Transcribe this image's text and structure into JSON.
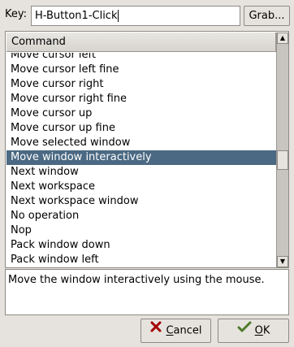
{
  "key": {
    "label": "Key:",
    "value": "H-Button1-Click",
    "grab_label": "Grab..."
  },
  "list": {
    "column_header": "Command",
    "rows": [
      "Move cursor left",
      "Move cursor left fine",
      "Move cursor right",
      "Move cursor right fine",
      "Move cursor up",
      "Move cursor up fine",
      "Move selected window",
      "Move window interactively",
      "Next window",
      "Next workspace",
      "Next workspace window",
      "No operation",
      "Nop",
      "Pack window down",
      "Pack window left"
    ],
    "selected_index": 7
  },
  "description": "Move the window interactively using the mouse.",
  "buttons": {
    "cancel_mnemonic": "C",
    "cancel_rest": "ancel",
    "ok_mnemonic": "O",
    "ok_rest": "K"
  },
  "colors": {
    "selection": "#4b6983",
    "window_bg": "#e6e3de"
  }
}
